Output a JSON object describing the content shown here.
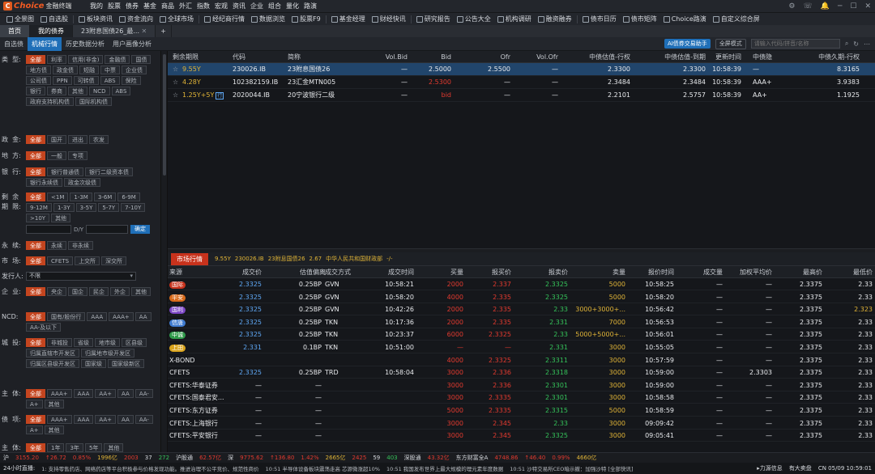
{
  "app": {
    "brand": "Choice",
    "brand_sub": "金融终端",
    "version": "v6.0"
  },
  "menu": [
    "我的",
    "股票",
    "债券",
    "基金",
    "商品",
    "外汇",
    "指数",
    "宏观",
    "资讯",
    "企业",
    "组合",
    "量化",
    "路演"
  ],
  "window_controls": [
    "⚙",
    "☎",
    "1",
    "─",
    "□",
    "✕"
  ],
  "toolbar": {
    "items": [
      "全景图",
      "自选股",
      "板块资讯",
      "资金流向",
      "全球市场",
      "经纪商行情",
      "数据浏览",
      "股票F9",
      "基金经理",
      "财经快讯",
      "研究报告",
      "公告大全",
      "机构调研",
      "融资融券",
      "债市日历",
      "债市矩阵",
      "Choice路演",
      "自定义综合屏"
    ]
  },
  "tabs": [
    {
      "label": "首页"
    },
    {
      "label": "我的债券"
    },
    {
      "label": "23附息国债26_最..."
    },
    {
      "label": "+"
    }
  ],
  "subtabs": [
    "自选债",
    "机械行情",
    "历史数据分析",
    "用户画像分析"
  ],
  "subtabs_right": {
    "ai": "AI债券交易助手",
    "mode": "全屏模式",
    "search_placeholder": "请输入代码/拼音/名称"
  },
  "filter": {
    "type_label": "类  型:",
    "type_chips": [
      "全部",
      "利率",
      "信用(非金)",
      "金融债",
      "国债",
      "地方债",
      "政金债",
      "短融",
      "中票",
      "企业债",
      "公司债",
      "PPN",
      "可转债",
      "ABS",
      "保险",
      "银行",
      "券商",
      "其他",
      "NCD",
      "ABS",
      "政府支持机构债",
      "国际机构债"
    ],
    "policy_label": "政  金:",
    "policy_chips": [
      "全部",
      "国开",
      "进出",
      "农发"
    ],
    "local_label": "地  方:",
    "local_chips": [
      "全部",
      "一般",
      "专项"
    ],
    "bank_label": "银  行:",
    "bank_chips": [
      "全部",
      "银行普通债",
      "银行二级资本债",
      "银行永续债",
      "政金次级债"
    ],
    "term_label": "剩  余\n期  限:",
    "term_chips": [
      "全部",
      "<1M",
      "1-3M",
      "3-6M",
      "6-9M",
      "9-12M",
      "1-3Y",
      "3-5Y",
      "5-7Y",
      "7-10Y",
      ">10Y",
      "其他"
    ],
    "term_unit": "D/Y",
    "confirm": "确定",
    "perp_label": "永  续:",
    "perp_chips": [
      "全部",
      "永续",
      "非永续"
    ],
    "market_label": "市  场:",
    "market_chips": [
      "全部",
      "CFETS",
      "上交所",
      "深交所"
    ],
    "issuer_label": "发行人:",
    "issuer_value": "不限",
    "corp_label": "企  业:",
    "corp_chips": [
      "全部",
      "央企",
      "国企",
      "民企",
      "外企",
      "其他"
    ],
    "ncd_label": "NCD:",
    "ncd_chips": [
      "全部",
      "国有/股份行",
      "AAA",
      "AAA+",
      "AA",
      "AA-及以下"
    ],
    "city_label": "城  投:",
    "city_chips": [
      "全部",
      "非城投",
      "省级",
      "地市级",
      "区县级",
      "归属直辖市开发区",
      "归属地市级开发区",
      "归属区县级开发区",
      "国家级",
      "国家级新区"
    ],
    "subj_label": "主  体:",
    "subj_chips": [
      "全部",
      "AAA+",
      "AAA",
      "AA+",
      "AA",
      "AA-",
      "A+",
      "其他"
    ],
    "bond_label": "债  项:",
    "bond_chips": [
      "全部",
      "AAA+",
      "AAA",
      "AA+",
      "AA",
      "AA-",
      "A+",
      "其他"
    ],
    "mat_label": "主  体:",
    "mat_chips": [
      "全部",
      "1年",
      "3年",
      "5年",
      "其他"
    ]
  },
  "upper_grid": {
    "columns": [
      "剩余期限",
      "代码",
      "简称",
      "Vol.Bid",
      "Bid",
      "Ofr",
      "Vol.Ofr",
      "中债估值-行权",
      "中债估值-到期",
      "更新时间",
      "中债隐",
      "中债久期-行权"
    ],
    "rows": [
      {
        "term": "9.55Y",
        "code": "230026.IB",
        "name": "23附息国债26",
        "vbid": "—",
        "bid": "2.5000",
        "ofr": "2.5500",
        "vofr": "—",
        "val_ex": "2.3300",
        "val_mat": "2.3300",
        "time": "10:58:39",
        "implied": "—",
        "dur": "8.3165"
      },
      {
        "term": "4.28Y",
        "code": "102382159.IB",
        "name": "23汇金MTN005",
        "vbid": "—",
        "bid": "2.5300",
        "ofr": "—",
        "vofr": "—",
        "val_ex": "2.3484",
        "val_mat": "2.3484",
        "time": "10:58:39",
        "implied": "AAA+",
        "dur": "3.9383"
      },
      {
        "term": "1.25Y+5Y",
        "tag": "行",
        "code": "2020044.IB",
        "name": "20宁波银行二级",
        "vbid": "—",
        "bid": "bid",
        "ofr": "—",
        "vofr": "—",
        "val_ex": "2.2101",
        "val_mat": "2.5757",
        "time": "10:58:39",
        "implied": "AA+",
        "dur": "1.1925"
      }
    ]
  },
  "quote_bar": {
    "title": "市场行情",
    "term": "9.55Y",
    "code": "230026.IB",
    "name": "23附息国债26",
    "val": "2.67",
    "issuer": "中华人民共和国财政部",
    "extra": "-/-"
  },
  "lower_grid": {
    "columns": [
      "来源",
      "成交价",
      "估值偏离",
      "成交方式",
      "成交时间",
      "买量",
      "报买价",
      "报卖价",
      "卖量",
      "报价时间",
      "成交量",
      "加权平均价",
      "最高价",
      "最低价"
    ],
    "rows": [
      {
        "src": "国际",
        "badge": "#c7321c",
        "price": "2.3325",
        "dev": "0.25BP",
        "mode": "GVN",
        "time": "10:58:21",
        "bvol": "2000",
        "bid": "2.337",
        "ask": "2.3325",
        "avol": "5000",
        "qtime": "10:58:25",
        "vol": "—",
        "wavg": "—",
        "hi": "2.3375",
        "lo": "2.33"
      },
      {
        "src": "平安",
        "badge": "#d86a1a",
        "price": "2.3325",
        "dev": "0.25BP",
        "mode": "GVN",
        "time": "10:58:20",
        "bvol": "4000",
        "bid": "2.335",
        "ask": "2.3325",
        "avol": "5000",
        "qtime": "10:58:20",
        "vol": "—",
        "wavg": "—",
        "hi": "2.3375",
        "lo": "2.33"
      },
      {
        "src": "国利",
        "badge": "#7a45c4",
        "price": "2.3325",
        "dev": "0.25BP",
        "mode": "GVN",
        "time": "10:42:26",
        "bvol": "2000",
        "bid": "2.335",
        "ask": "2.33",
        "avol": "3000+3000+...",
        "qtime": "10:56:42",
        "vol": "—",
        "wavg": "—",
        "hi": "2.3375",
        "lo": "2.323"
      },
      {
        "src": "信唐",
        "badge": "#3f7bd0",
        "price": "2.3325",
        "dev": "0.25BP",
        "mode": "TKN",
        "time": "10:17:36",
        "bvol": "2000",
        "bid": "2.335",
        "ask": "2.331",
        "avol": "7000",
        "qtime": "10:56:53",
        "vol": "—",
        "wavg": "—",
        "hi": "2.3375",
        "lo": "2.33"
      },
      {
        "src": "中诚",
        "badge": "#2f9a4a",
        "price": "2.3325",
        "dev": "0.25BP",
        "mode": "TKN",
        "time": "10:23:37",
        "bvol": "6000",
        "bid": "2.3325",
        "ask": "2.33",
        "avol": "5000+5000+...",
        "qtime": "10:56:01",
        "vol": "—",
        "wavg": "—",
        "hi": "2.3375",
        "lo": "2.33"
      },
      {
        "src": "上田",
        "badge": "#d9a31c",
        "price": "2.331",
        "dev": "0.1BP",
        "mode": "TKN",
        "time": "10:51:00",
        "bvol": "—",
        "bid": "—",
        "ask": "2.331",
        "avol": "3000",
        "qtime": "10:55:05",
        "vol": "—",
        "wavg": "—",
        "hi": "2.3375",
        "lo": "2.33"
      },
      {
        "src": "X-BOND",
        "price": "",
        "dev": "",
        "mode": "",
        "time": "",
        "bvol": "4000",
        "bid": "2.3325",
        "ask": "2.3311",
        "avol": "3000",
        "qtime": "10:57:59",
        "vol": "—",
        "wavg": "—",
        "hi": "2.3375",
        "lo": "2.33"
      },
      {
        "src": "CFETS",
        "price": "2.3325",
        "dev": "0.25BP",
        "mode": "TRD",
        "time": "10:58:04",
        "bvol": "3000",
        "bid": "2.336",
        "ask": "2.3318",
        "avol": "3000",
        "qtime": "10:59:00",
        "vol": "—",
        "wavg": "2.3303",
        "hi": "2.3375",
        "lo": "2.33"
      },
      {
        "src": "CFETS:华泰证券",
        "price": "—",
        "dev": "—",
        "mode": "",
        "time": "",
        "bvol": "3000",
        "bid": "2.336",
        "ask": "2.3301",
        "avol": "3000",
        "qtime": "10:59:00",
        "vol": "—",
        "wavg": "—",
        "hi": "2.3375",
        "lo": "2.33"
      },
      {
        "src": "CFETS:国泰君安...",
        "price": "—",
        "dev": "—",
        "mode": "",
        "time": "",
        "bvol": "3000",
        "bid": "2.3335",
        "ask": "2.3301",
        "avol": "3000",
        "qtime": "10:58:58",
        "vol": "—",
        "wavg": "—",
        "hi": "2.3375",
        "lo": "2.33"
      },
      {
        "src": "CFETS:东方证券",
        "price": "—",
        "dev": "—",
        "mode": "",
        "time": "",
        "bvol": "5000",
        "bid": "2.3335",
        "ask": "2.3315",
        "avol": "5000",
        "qtime": "10:58:59",
        "vol": "—",
        "wavg": "—",
        "hi": "2.3375",
        "lo": "2.33"
      },
      {
        "src": "CFETS:上海银行",
        "price": "—",
        "dev": "—",
        "mode": "",
        "time": "",
        "bvol": "3000",
        "bid": "2.345",
        "ask": "2.33",
        "avol": "3000",
        "qtime": "09:09:42",
        "vol": "—",
        "wavg": "—",
        "hi": "2.3375",
        "lo": "2.33"
      },
      {
        "src": "CFETS:平安银行",
        "price": "—",
        "dev": "—",
        "mode": "",
        "time": "",
        "bvol": "3000",
        "bid": "2.345",
        "ask": "2.3325",
        "avol": "3000",
        "qtime": "09:05:41",
        "vol": "—",
        "wavg": "—",
        "hi": "2.3375",
        "lo": "2.33"
      }
    ]
  },
  "status1": [
    {
      "t": "沪",
      "c": "#d8dbe0"
    },
    {
      "t": "3155.20",
      "c": "#e33a2f"
    },
    {
      "t": "↑26.72",
      "c": "#e33a2f"
    },
    {
      "t": "0.85%",
      "c": "#e33a2f"
    },
    {
      "t": "1996亿",
      "c": "#e0b437"
    },
    {
      "t": "2003",
      "c": "#e33a2f"
    },
    {
      "t": "37",
      "c": "#d8dbe0"
    },
    {
      "t": "272",
      "c": "#35c35a"
    },
    {
      "t": "沪股通",
      "c": "#d8dbe0"
    },
    {
      "t": "62.57亿",
      "c": "#e33a2f"
    },
    {
      "t": "深",
      "c": "#d8dbe0"
    },
    {
      "t": "9775.62",
      "c": "#e33a2f"
    },
    {
      "t": "↑136.80",
      "c": "#e33a2f"
    },
    {
      "t": "1.42%",
      "c": "#e33a2f"
    },
    {
      "t": "2665亿",
      "c": "#e0b437"
    },
    {
      "t": "2425",
      "c": "#e33a2f"
    },
    {
      "t": "59",
      "c": "#d8dbe0"
    },
    {
      "t": "403",
      "c": "#35c35a"
    },
    {
      "t": "深股通",
      "c": "#d8dbe0"
    },
    {
      "t": "43.32亿",
      "c": "#e33a2f"
    },
    {
      "t": "东方财富全A",
      "c": "#d8dbe0"
    },
    {
      "t": "4748.86",
      "c": "#e33a2f"
    },
    {
      "t": "↑46.40",
      "c": "#e33a2f"
    },
    {
      "t": "0.99%",
      "c": "#e33a2f"
    },
    {
      "t": "4660亿",
      "c": "#e0b437"
    }
  ],
  "status2": {
    "label": "24小时直播:",
    "news": [
      "1: 支持零售药店、网络药店等平台积极参与价格发现功能。推进治理不公平竞价、规范性商价",
      "10:51 半导体设备板块震荡走高 芯源微涨超10%",
      "10:51 我国发布世界上最大规模的理元素年度数据",
      "10:51 沙特交易所CEO暗示撤：加强沙特 [全部快讯]"
    ],
    "right": [
      "▸力源信息",
      "有大卖盘"
    ],
    "clock": "CN 05/09 10:59:01"
  }
}
